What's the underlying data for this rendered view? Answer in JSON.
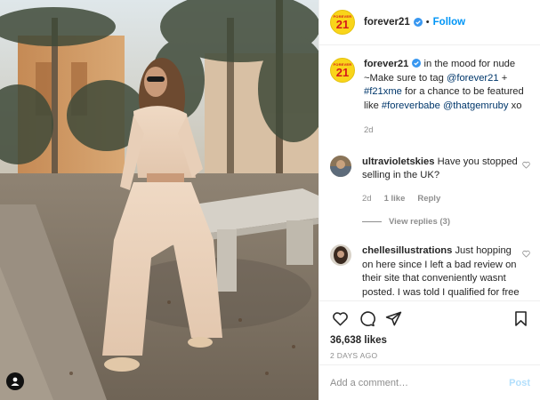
{
  "account": {
    "username": "forever21",
    "follow_label": "Follow",
    "separator": "•",
    "avatar_small_text": "FOREVER",
    "avatar_big_text": "21",
    "brand_color": "#f9d51a",
    "logo_text_color": "#d51a1a"
  },
  "caption": {
    "username": "forever21",
    "text_1": " in the mood for nude ~Make sure to tag ",
    "mention_1": "@forever21",
    "text_2": " + ",
    "hashtag_1": "#f21xme",
    "text_3": " for a chance to be featured like ",
    "hashtag_2": "#foreverbabe",
    "text_4": " ",
    "mention_2": "@thatgemruby",
    "text_5": " xo",
    "time": "2d"
  },
  "comments": [
    {
      "username": "ultravioletskies",
      "text": " Have you stopped selling in the UK?",
      "time": "2d",
      "likes": "1 like",
      "reply_label": "Reply",
      "view_replies": "View replies (3)"
    },
    {
      "username": "chellesillustrations",
      "text": " Just hopping on here since I left a bad review on their site that conveniently wasnt posted. I was told I qualified for free shipping but my large order was sent standard and wont be here in time for the trip that I ordered it for"
    }
  ],
  "actions": {
    "like_icon": "heart-icon",
    "comment_icon": "comment-icon",
    "share_icon": "paper-plane-icon",
    "save_icon": "bookmark-icon"
  },
  "likes_text": "36,638 likes",
  "posted_time": "2 DAYS AGO",
  "add_comment": {
    "placeholder": "Add a comment…",
    "post_label": "Post"
  },
  "colors": {
    "link_blue": "#0095f6",
    "mention_color": "#00376b",
    "muted_gray": "#8e8e8e",
    "post_disabled": "#b2dffc",
    "border": "#efefef"
  }
}
